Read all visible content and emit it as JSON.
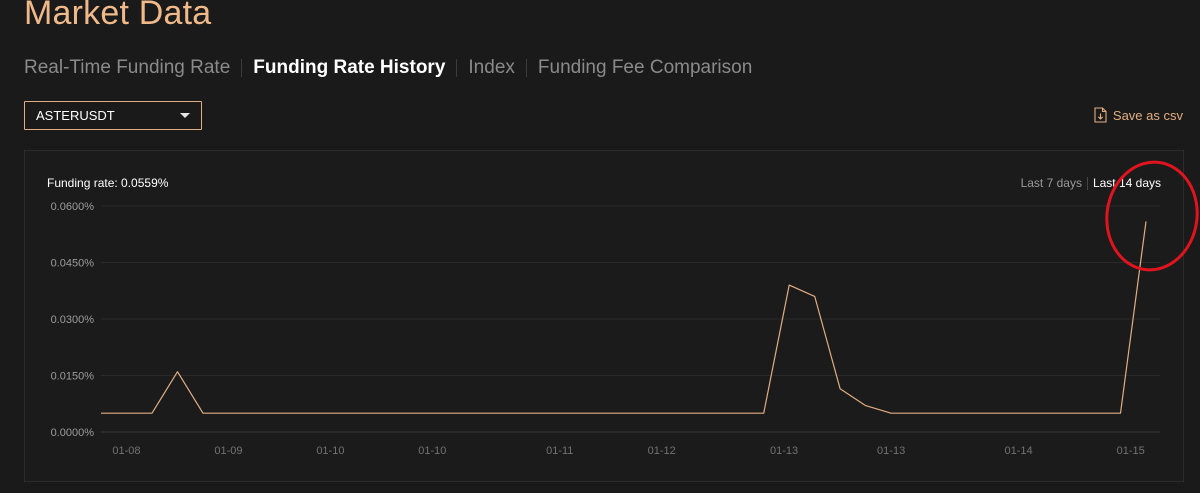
{
  "page": {
    "title": "Market Data"
  },
  "tabs": [
    {
      "label": "Real-Time Funding Rate"
    },
    {
      "label": "Funding Rate History"
    },
    {
      "label": "Index"
    },
    {
      "label": "Funding Fee Comparison"
    }
  ],
  "active_tab_index": 1,
  "symbol_select": {
    "value": "ASTERUSDT"
  },
  "save_csv": {
    "label": "Save as csv",
    "icon": "file-download-icon"
  },
  "chart_header": {
    "funding_rate_label": "Funding rate: 0.0559%",
    "range_options": [
      {
        "label": "Last 7 days"
      },
      {
        "label": "Last 14 days"
      }
    ],
    "active_range_index": 1
  },
  "colors": {
    "accent": "#f0b98a",
    "line": "#e2ad82",
    "annotation": "#e0141e",
    "background": "#1a1a1a"
  },
  "chart_data": {
    "type": "line",
    "title": "",
    "xlabel": "",
    "ylabel": "",
    "ylim": [
      0,
      0.06
    ],
    "y_ticks": [
      "0.0600%",
      "0.0450%",
      "0.0300%",
      "0.0150%",
      "0.0000%"
    ],
    "x_ticks": [
      "01-08",
      "01-09",
      "01-10",
      "01-10",
      "01-11",
      "01-12",
      "01-13",
      "01-13",
      "01-14",
      "01-15"
    ],
    "grid": true,
    "x": [
      0,
      2,
      3,
      4,
      26,
      27,
      28,
      29,
      30,
      31,
      40,
      41
    ],
    "y": [
      0.005,
      0.005,
      0.016,
      0.005,
      0.005,
      0.039,
      0.036,
      0.0115,
      0.007,
      0.005,
      0.005,
      0.0559
    ],
    "series": [
      {
        "values": [
          0.005,
          0.005,
          0.016,
          0.005,
          0.005,
          0.039,
          0.036,
          0.0115,
          0.007,
          0.005,
          0.005,
          0.0559
        ]
      }
    ]
  }
}
